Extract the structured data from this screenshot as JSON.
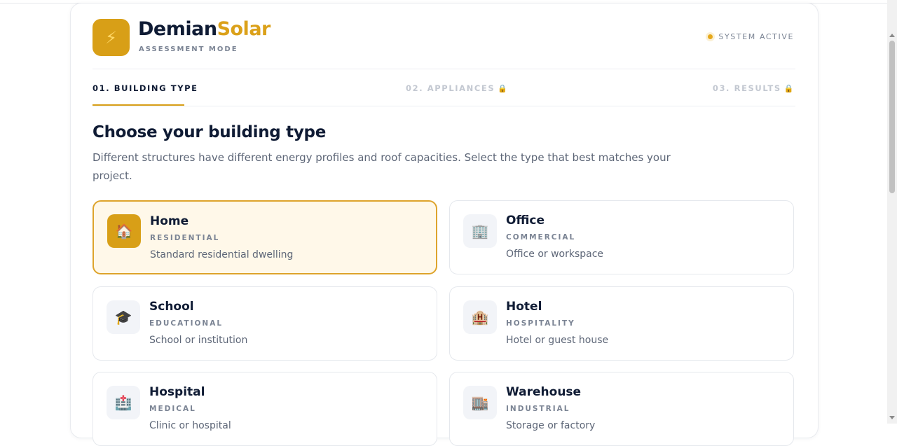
{
  "brand": {
    "name_part1": "Demian",
    "name_part2": "Solar",
    "mode": "ASSESSMENT MODE",
    "logo_icon": "⚡"
  },
  "status": {
    "label": "SYSTEM ACTIVE",
    "color": "#e6a81a"
  },
  "steps": [
    {
      "label": "01. BUILDING TYPE",
      "active": true,
      "locked": false
    },
    {
      "label": "02. APPLIANCES",
      "active": false,
      "locked": true
    },
    {
      "label": "03. RESULTS",
      "active": false,
      "locked": true
    }
  ],
  "lock_icon": "🔒",
  "page": {
    "heading": "Choose your building type",
    "description": "Different structures have different energy profiles and roof capacities. Select the type that best matches your project."
  },
  "building_types": [
    {
      "title": "Home",
      "category": "RESIDENTIAL",
      "description": "Standard residential dwelling",
      "icon": "🏠",
      "selected": true
    },
    {
      "title": "Office",
      "category": "COMMERCIAL",
      "description": "Office or workspace",
      "icon": "🏢",
      "selected": false
    },
    {
      "title": "School",
      "category": "EDUCATIONAL",
      "description": "School or institution",
      "icon": "🎓",
      "selected": false
    },
    {
      "title": "Hotel",
      "category": "HOSPITALITY",
      "description": "Hotel or guest house",
      "icon": "🏨",
      "selected": false
    },
    {
      "title": "Hospital",
      "category": "MEDICAL",
      "description": "Clinic or hospital",
      "icon": "🏥",
      "selected": false
    },
    {
      "title": "Warehouse",
      "category": "INDUSTRIAL",
      "description": "Storage or factory",
      "icon": "🏬",
      "selected": false
    }
  ],
  "colors": {
    "accent": "#d89f17",
    "navy": "#0f1b34",
    "selected_bg": "#fff8e9"
  }
}
